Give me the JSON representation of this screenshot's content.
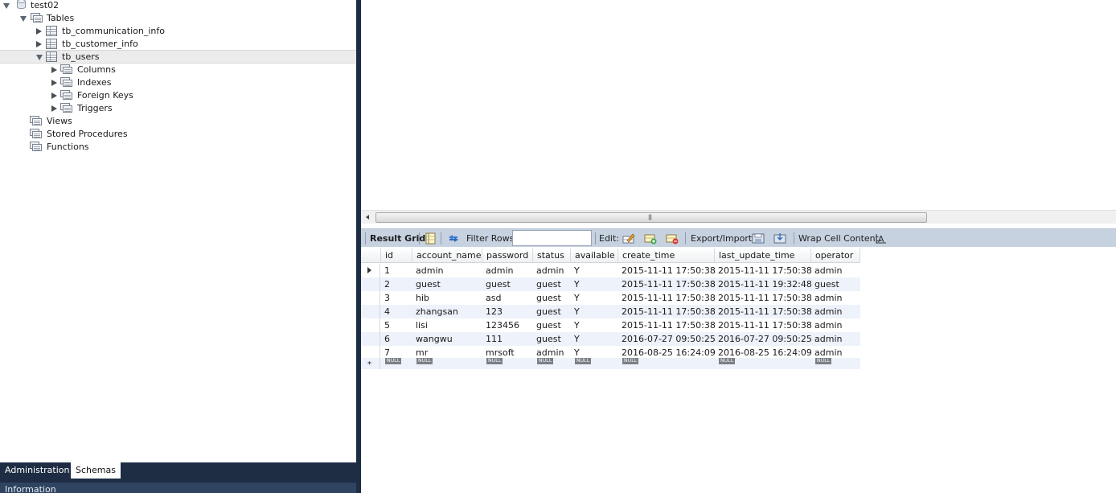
{
  "navigator": {
    "schema": "test02",
    "tables_label": "Tables",
    "tables": [
      "tb_communication_info",
      "tb_customer_info",
      "tb_users"
    ],
    "table_children": [
      "Columns",
      "Indexes",
      "Foreign Keys",
      "Triggers"
    ],
    "views_label": "Views",
    "procedures_label": "Stored Procedures",
    "functions_label": "Functions",
    "tabs": [
      "Administration",
      "Schemas"
    ],
    "active_tab": "Schemas",
    "info_label": "Information"
  },
  "toolbar": {
    "result_grid": "Result Grid",
    "filter_rows": "Filter Rows:",
    "filter_value": "",
    "edit": "Edit:",
    "export_import": "Export/Import:",
    "wrap_cell": "Wrap Cell Content:"
  },
  "grid": {
    "columns": [
      "id",
      "account_name",
      "password",
      "status",
      "available",
      "create_time",
      "last_update_time",
      "operator"
    ],
    "rows": [
      [
        "1",
        "admin",
        "admin",
        "admin",
        "Y",
        "2015-11-11 17:50:38",
        "2015-11-11 17:50:38",
        "admin"
      ],
      [
        "2",
        "guest",
        "guest",
        "guest",
        "Y",
        "2015-11-11 17:50:38",
        "2015-11-11 19:32:48",
        "guest"
      ],
      [
        "3",
        "hib",
        "asd",
        "guest",
        "Y",
        "2015-11-11 17:50:38",
        "2015-11-11 17:50:38",
        "admin"
      ],
      [
        "4",
        "zhangsan",
        "123",
        "guest",
        "Y",
        "2015-11-11 17:50:38",
        "2015-11-11 17:50:38",
        "admin"
      ],
      [
        "5",
        "lisi",
        "123456",
        "guest",
        "Y",
        "2015-11-11 17:50:38",
        "2015-11-11 17:50:38",
        "admin"
      ],
      [
        "6",
        "wangwu",
        "111",
        "guest",
        "Y",
        "2016-07-27 09:50:25",
        "2016-07-27 09:50:25",
        "admin"
      ],
      [
        "7",
        "mr",
        "mrsoft",
        "admin",
        "Y",
        "2016-08-25 16:24:09",
        "2016-08-25 16:24:09",
        "admin"
      ]
    ],
    "null_text": "NULL",
    "new_row_marker": "*"
  },
  "colors": {
    "sidebar_dark": "#1e2d44",
    "toolbar_bg": "#c7d2e0",
    "alt_row": "#eef2fb",
    "selected_row": "#ececec"
  },
  "icons": [
    "database-icon",
    "folder-icon",
    "table-icon",
    "columns-icon",
    "indexes-icon",
    "foreign-keys-icon",
    "triggers-icon",
    "form-editor-icon",
    "refresh-icon",
    "edit-row-icon",
    "insert-row-icon",
    "delete-row-icon",
    "export-icon",
    "import-icon",
    "wrap-text-icon"
  ]
}
